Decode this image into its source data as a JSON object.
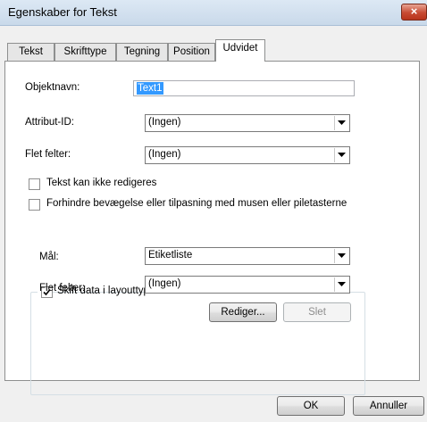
{
  "window": {
    "title": "Egenskaber for Tekst",
    "close_label": "×"
  },
  "tabs": [
    {
      "label": "Tekst"
    },
    {
      "label": "Skrifttype"
    },
    {
      "label": "Tegning"
    },
    {
      "label": "Position"
    },
    {
      "label": "Udvidet"
    }
  ],
  "form": {
    "object_name_label": "Objektnavn:",
    "object_name_value": "Text1",
    "attribute_id_label": "Attribut-ID:",
    "attribute_id_value": "(Ingen)",
    "merge_fields_label": "Flet felter:",
    "merge_fields_value": "(Ingen)",
    "not_editable_label": "Tekst kan ikke redigeres",
    "not_editable_checked": false,
    "prevent_move_label": "Forhindre bevægelse eller tilpasning med musen eller piletasterne",
    "prevent_move_checked": false
  },
  "layout_group": {
    "switch_data_label": "Skift data i layouttype-skabelon",
    "switch_data_checked": true,
    "target_label": "Mål:",
    "target_value": "Etiketliste",
    "merge_fields_label": "Flet felter:",
    "merge_fields_value": "(Ingen)",
    "edit_button": "Rediger...",
    "delete_button": "Slet"
  },
  "footer": {
    "ok_button": "OK",
    "cancel_button": "Annuller"
  },
  "colors": {
    "selection": "#3399ff",
    "titlebar": "#c9d9ea",
    "close": "#c74a32"
  },
  "icons": {
    "close": "close-icon",
    "dropdown": "chevron-down-icon",
    "check": "checkmark-icon"
  }
}
